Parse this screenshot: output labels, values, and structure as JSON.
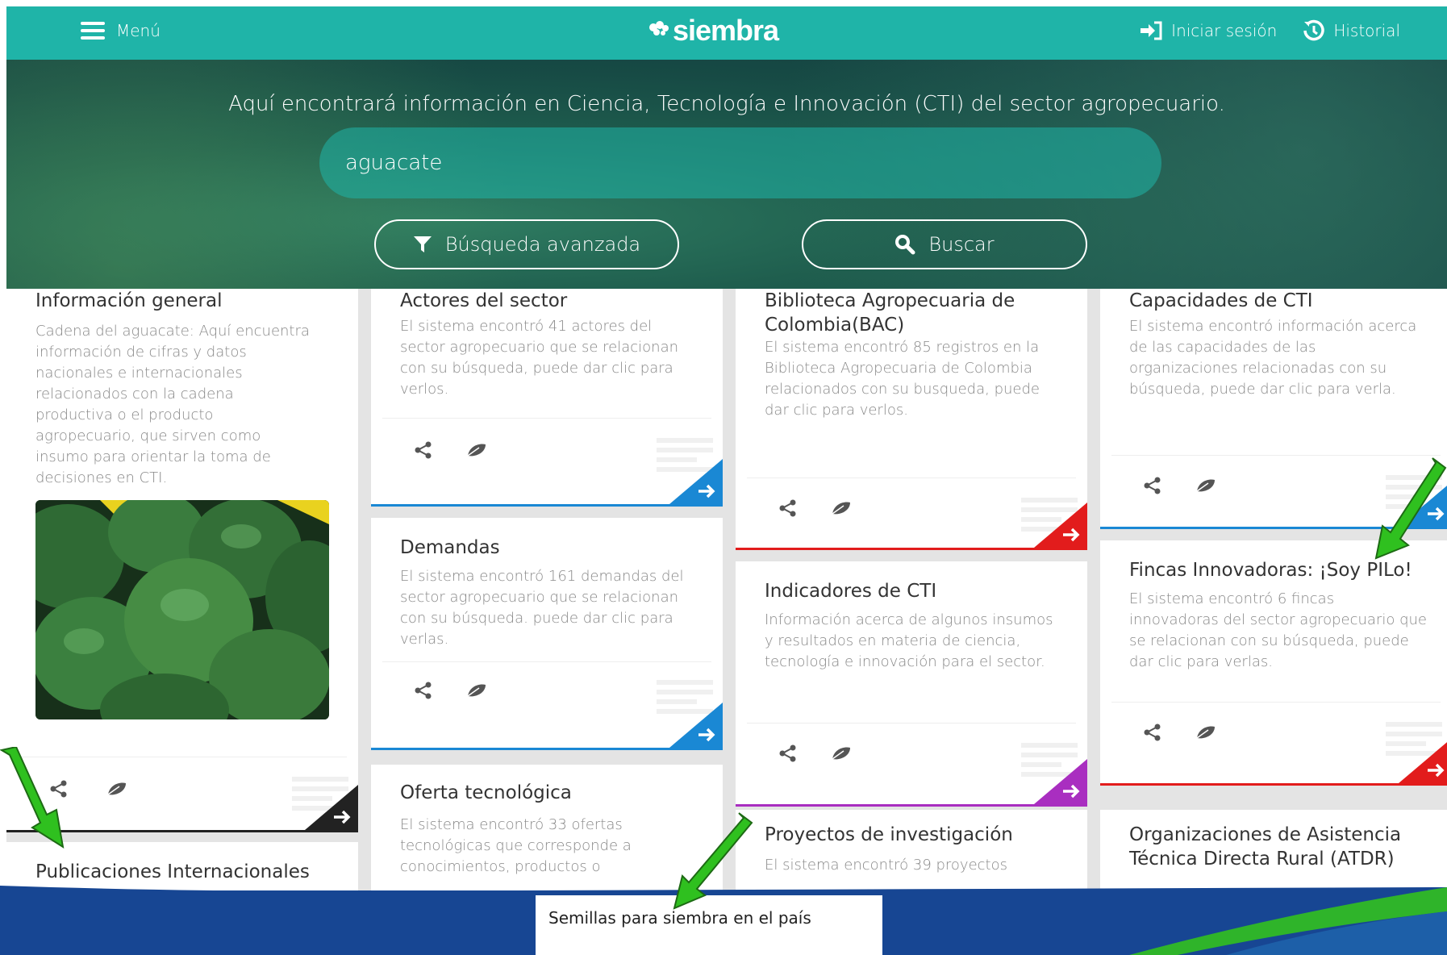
{
  "navbar": {
    "menu_label": "Menú",
    "logo_text": "siembra",
    "login_label": "Iniciar sesión",
    "history_label": "Historial",
    "accent_color": "#1fb4a8"
  },
  "hero": {
    "tagline": "Aquí encontrará información en Ciencia, Tecnología e Innovación (CTI) del sector agropecuario.",
    "search_value": "aguacate",
    "advanced_label": "Búsqueda avanzada",
    "search_label": "Buscar"
  },
  "cards": {
    "info_general": {
      "title": "Información general",
      "desc": "Cadena del aguacate: Aquí encuentra información de cifras y datos nacionales e internacionales relacionados con la cadena productiva o el producto agropecuario, que sirven como insumo para orientar la toma de decisiones en CTI.",
      "accent": "#222222"
    },
    "publicaciones": {
      "title": "Publicaciones Internacionales"
    },
    "actores": {
      "title": "Actores del sector",
      "desc": "El sistema encontró 41 actores del sector agropecuario que se relacionan con su búsqueda, puede dar clic para verlos.",
      "accent": "#1a88d4"
    },
    "demandas": {
      "title": "Demandas",
      "desc": "El sistema encontró 161 demandas del sector agropecuario que se relacionan con su búsqueda. puede dar clic para verlas.",
      "accent": "#1a88d4"
    },
    "oferta": {
      "title": "Oferta tecnológica",
      "desc": "El sistema encontró 33 ofertas tecnológicas que corresponde a conocimientos, productos o"
    },
    "biblioteca": {
      "title": "Biblioteca Agropecuaria de Colombia(BAC)",
      "desc": "El sistema encontró 85 registros en la Biblioteca Agropecuaria de Colombia relacionados con su busqueda, puede dar clic para verlos.",
      "accent": "#e21c1c"
    },
    "indicadores": {
      "title": "Indicadores de CTI",
      "desc": "Información acerca de algunos insumos y resultados en materia de ciencia, tecnología e innovación para el sector.",
      "accent": "#a92ec0"
    },
    "proyectos": {
      "title": "Proyectos de investigación",
      "desc": "El sistema encontró 39 proyectos"
    },
    "capacidades": {
      "title": "Capacidades de CTI",
      "desc": "El sistema encontró información acerca de las capacidades de las organizaciones relacionadas con su búsqueda, puede dar clic para verla.",
      "accent": "#1a88d4"
    },
    "fincas": {
      "title": "Fincas Innovadoras: ¡Soy PILo!",
      "desc": "El sistema encontró 6 fincas innovadoras del sector agropecuario que se relacionan con su búsqueda, puede dar clic para verlas.",
      "accent": "#e21c1c"
    },
    "atdr": {
      "title": "Organizaciones de Asistencia Técnica Directa Rural (ATDR)"
    }
  },
  "tooltip": {
    "text": "Semillas para siembra en el país"
  },
  "colors": {
    "arrow_green": "#2fc01f",
    "band_blue": "#174693"
  }
}
